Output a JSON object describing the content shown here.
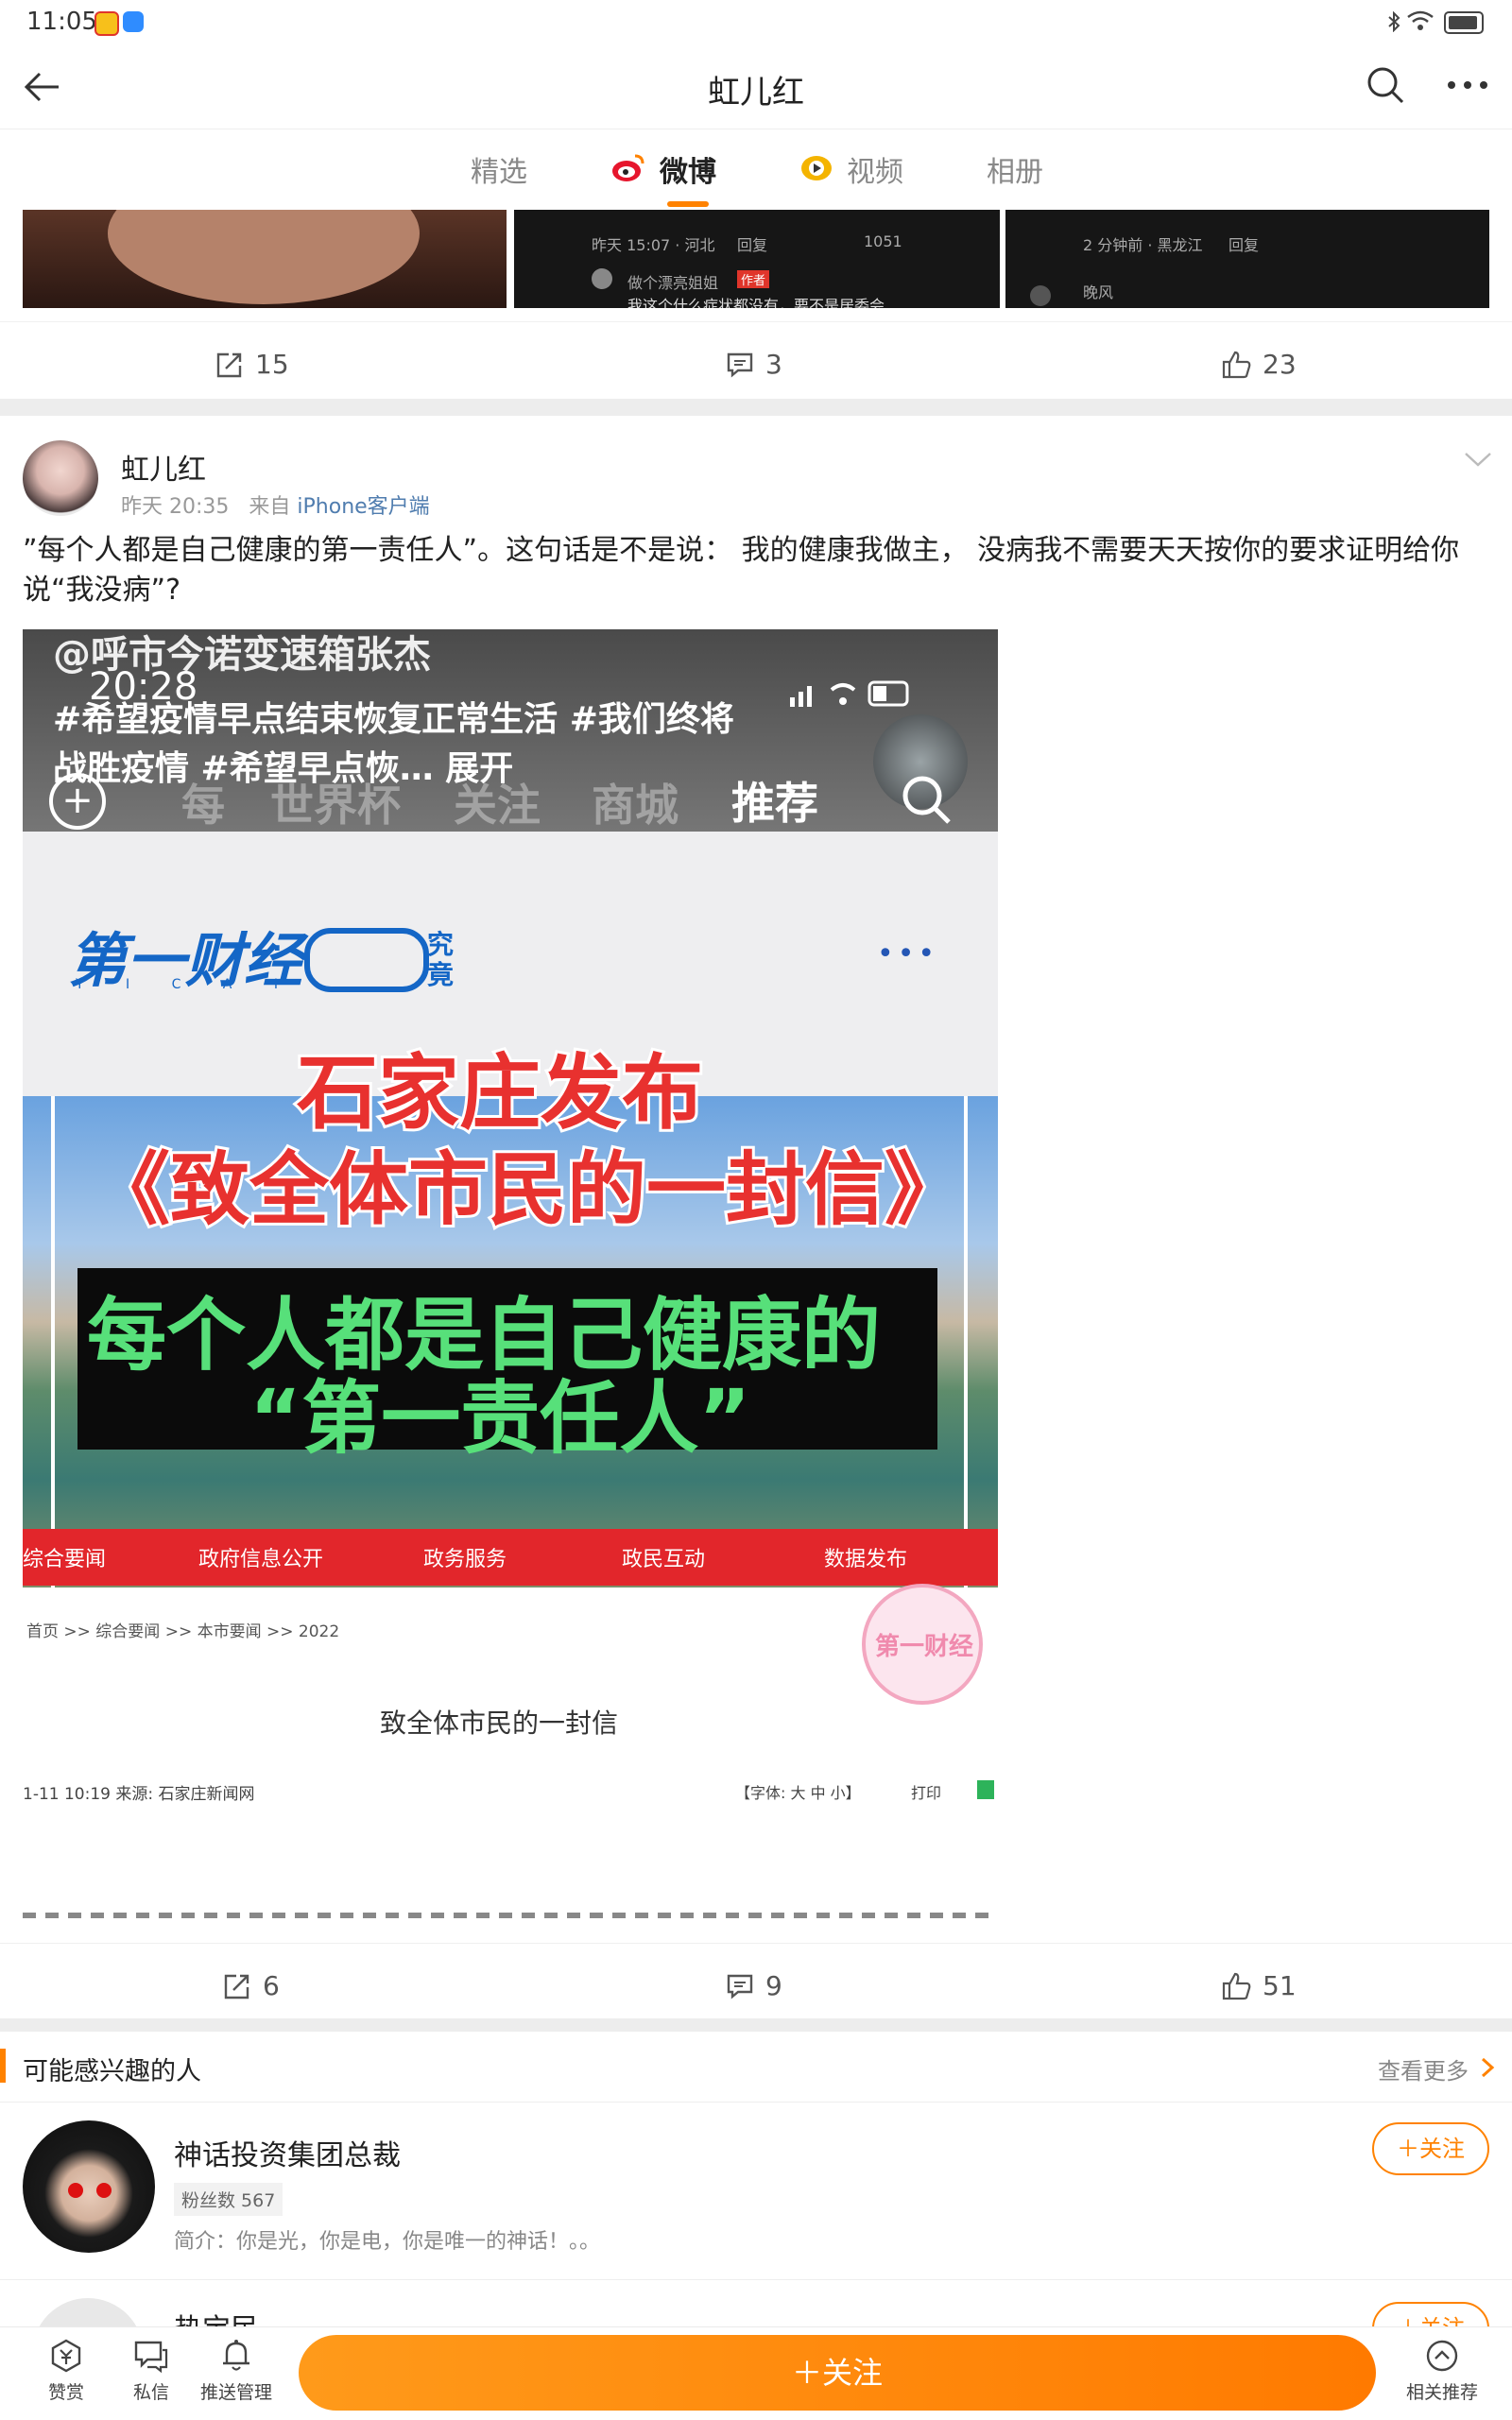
{
  "status_bar": {
    "time": "11:05"
  },
  "nav": {
    "title": "虹儿红"
  },
  "tabs": [
    {
      "label": "精选"
    },
    {
      "label": "微博"
    },
    {
      "label": "视频"
    },
    {
      "label": "相册"
    }
  ],
  "prev_post": {
    "thumb2": {
      "line1": "昨天 15:07 · 河北",
      "reply": "回复",
      "likes": "1051",
      "commenter": "做个漂亮姐姐",
      "badge": "作者",
      "comment": "我这个什么症状都没有，要不是居委会"
    },
    "thumb3": {
      "line1": "2 分钟前 · 黑龙江",
      "reply": "回复",
      "commenter": "晚风"
    },
    "actions": {
      "reposts": "15",
      "comments": "3",
      "likes": "23"
    }
  },
  "post": {
    "author": "虹儿红",
    "time": "昨天 20:35",
    "source_prefix": "来自",
    "source": "iPhone客户端",
    "text": "”每个人都是自己健康的第一责任人”。这句话是不是说： 我的健康我做主， 没病我不需要天天按你的要求证明给你说“我没病”?",
    "image": {
      "watermark_user": "@呼市今诺变速箱张杰",
      "clock": "20:28",
      "hashtags": "#希望疫情早点结束恢复正常生活 #我们终将战胜疫情 #希望早点恢…",
      "expand": "展开",
      "nav_faded": [
        "每",
        "世界杯",
        "关注",
        "商城"
      ],
      "nav_active": "推荐",
      "logo_text": "第一财经",
      "logo_sub": "Y I C A I",
      "logo_dot": "·",
      "logo_pill": "究竟",
      "more_dots": "•••",
      "headline1": "石家庄发布",
      "headline2": "《致全体市民的一封信》",
      "headline3": "每个人都是自己健康的",
      "headline4": "“第一责任人”",
      "gov_nav": [
        "综合要闻",
        "政府信息公开",
        "政务服务",
        "政民互动",
        "数据发布"
      ],
      "breadcrumb": "首页 >> 综合要闻 >> 本市要闻 >> 2022",
      "doc_title": "致全体市民的一封信",
      "doc_meta": "1-11 10:19  来源: 石家庄新闻网",
      "doc_font": "【字体: 大 中 小】",
      "doc_print": "打印",
      "stamp": "第一财经"
    },
    "actions": {
      "reposts": "6",
      "comments": "9",
      "likes": "51"
    }
  },
  "recommend": {
    "title": "可能感兴趣的人",
    "more": "查看更多",
    "users": [
      {
        "name": "神话投资集团总裁",
        "fans": "粉丝数 567",
        "bio": "简介：你是光，你是电，你是唯一的神话！。。",
        "follow": "＋关注"
      },
      {
        "name": "热宝民",
        "follow": "＋关注"
      }
    ]
  },
  "bottom_bar": {
    "reward": "赞赏",
    "message": "私信",
    "push": "推送管理",
    "follow": "＋关注",
    "related": "相关推荐"
  },
  "colors": {
    "accent": "#ff8200",
    "link": "#507daf",
    "red_banner": "#e8312f"
  }
}
